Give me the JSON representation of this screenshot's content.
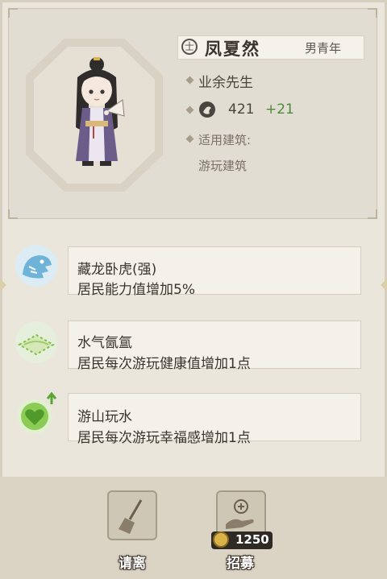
{
  "character": {
    "name": "凤夏然",
    "gender_icon_glyph": "士",
    "age_group": "男青年",
    "role": "业余先生",
    "stat_base": "421",
    "stat_bonus": "+21",
    "building_label": "适用建筑:",
    "building_value": "游玩建筑"
  },
  "skills": [
    {
      "title": "藏龙卧虎(强)",
      "desc": "居民能力值增加5%",
      "icon": "tiger-icon"
    },
    {
      "title": "水气氤氲",
      "desc": "居民每次游玩健康值增加1点",
      "icon": "mist-icon"
    },
    {
      "title": "游山玩水",
      "desc": "居民每次游玩幸福感增加1点",
      "icon": "heart-up-icon"
    }
  ],
  "actions": {
    "dismiss_label": "请离",
    "recruit_label": "招募",
    "recruit_cost": "1250"
  },
  "colors": {
    "bonus_green": "#4d8a36",
    "skill_icon_blue": "#6fb3d8",
    "skill_icon_green": "#7cc04a"
  }
}
